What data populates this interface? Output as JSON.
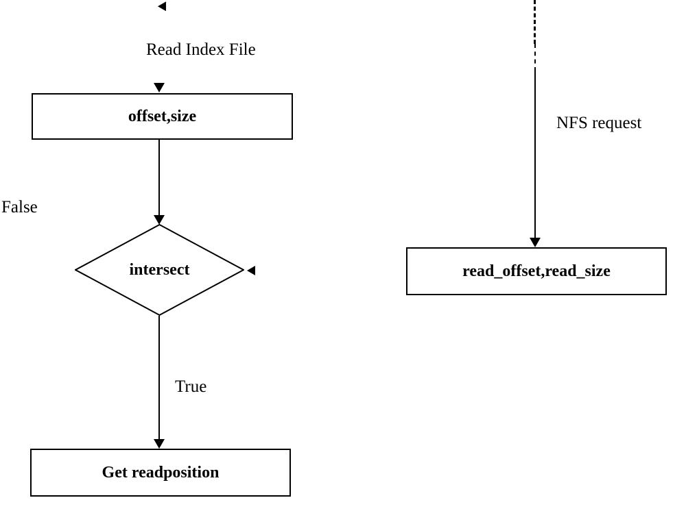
{
  "labels": {
    "read_index": "Read Index File",
    "nfs_request": "NFS request",
    "false": "False",
    "true": "True"
  },
  "boxes": {
    "offset_size": "offset,size",
    "read_offset_size": "read_offset,read_size",
    "get_readposition": "Get readposition"
  },
  "decision": {
    "intersect": "intersect"
  }
}
